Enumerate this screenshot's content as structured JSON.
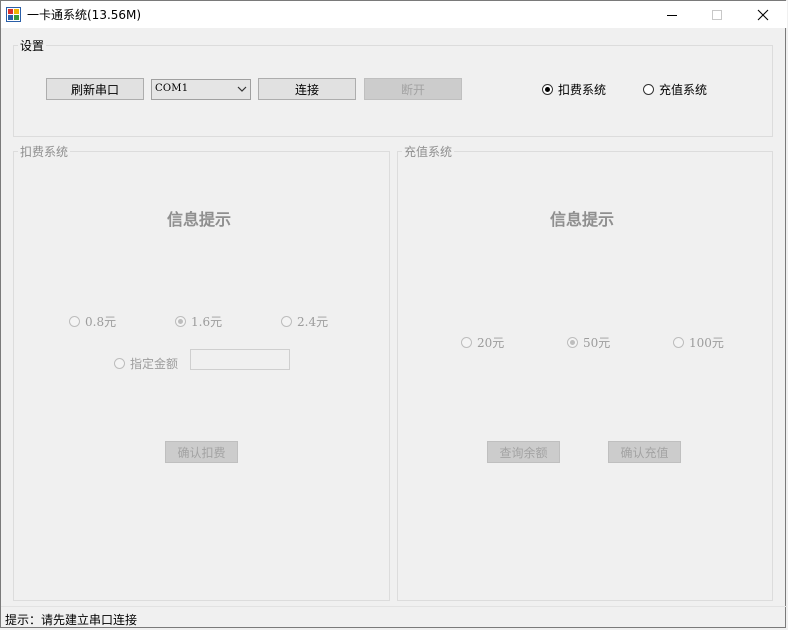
{
  "window": {
    "title": "一卡通系统(13.56M)"
  },
  "settings": {
    "legend": "设置",
    "refresh_label": "刷新串口",
    "port_value": "COM1",
    "connect_label": "连接",
    "disconnect_label": "断开",
    "mode_deduct_label": "扣费系统",
    "mode_recharge_label": "充值系统",
    "selected_mode": "扣费系统"
  },
  "deduct": {
    "legend": "扣费系统",
    "info_title": "信息提示",
    "options": [
      "0.8元",
      "1.6元",
      "2.4元"
    ],
    "selected_option": "1.6元",
    "custom_label": "指定金额",
    "custom_value": "",
    "confirm_label": "确认扣费"
  },
  "recharge": {
    "legend": "充值系统",
    "info_title": "信息提示",
    "options": [
      "20元",
      "50元",
      "100元"
    ],
    "selected_option": "50元",
    "query_label": "查询余额",
    "confirm_label": "确认充值"
  },
  "status": {
    "text": "提示：请先建立串口连接"
  }
}
